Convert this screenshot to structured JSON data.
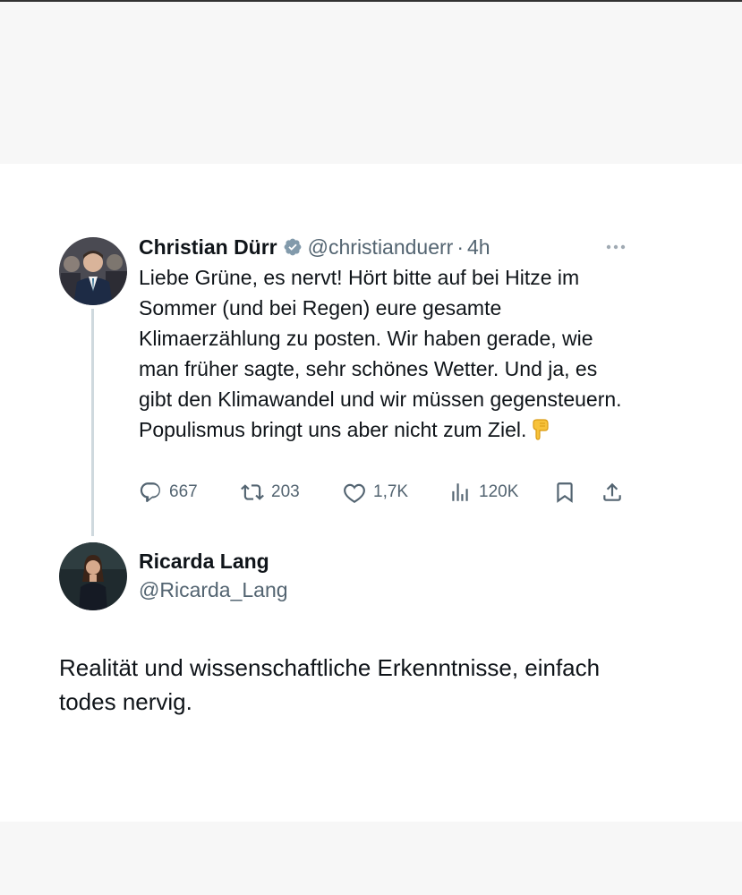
{
  "tweet": {
    "author_name": "Christian Dürr",
    "handle": "@christianduerr",
    "separator": "·",
    "time": "4h",
    "text": "Liebe Grüne, es nervt! Hört bitte auf bei Hitze im Sommer (und bei Regen) eure gesamte Klimaerzählung zu posten. Wir haben gerade, wie man früher sagte, sehr schönes Wetter. Und ja, es gibt den Klimawandel und wir müssen gegensteuern. Populismus bringt uns aber nicht zum Ziel.",
    "emoji": "pointing-down-hand",
    "stats": {
      "replies": "667",
      "retweets": "203",
      "likes": "1,7K",
      "views": "120K"
    },
    "icons": [
      "verified-badge-icon",
      "more-icon",
      "reply-icon",
      "retweet-icon",
      "like-icon",
      "views-icon",
      "bookmark-icon",
      "share-icon"
    ]
  },
  "reply": {
    "author_name": "Ricarda Lang",
    "handle": "@Ricarda_Lang",
    "text": "Realität und wissenschaftliche Erkenntnisse, einfach todes nervig."
  },
  "colors": {
    "text_primary": "#0f1419",
    "text_secondary": "#536471",
    "verified_badge": "#829aab",
    "thread_line": "#cfd9de",
    "background_band": "#f7f7f7"
  }
}
